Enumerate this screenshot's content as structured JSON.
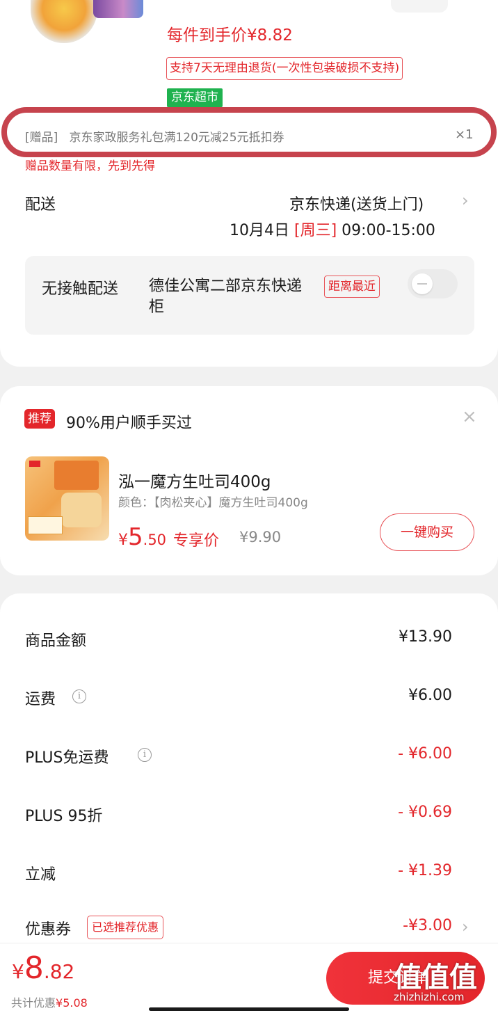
{
  "product": {
    "final_price": "每件到手价¥8.82",
    "return_policy": "支持7天无理由退货(一次性包装破损不支持)",
    "store_badge": "京东超市"
  },
  "gift": {
    "tag": "[赠品]",
    "name": "京东家政服务礼包满120元减25元抵扣券",
    "qty": "×1",
    "note": "赠品数量有限，先到先得"
  },
  "delivery": {
    "label": "配送",
    "method": "京东快递(送货上门)",
    "date": "10月4日",
    "weekday": "[周三]",
    "time": "09:00-15:00",
    "contactless_label": "无接触配送",
    "contactless_location": "德佳公寓二部京东快递柜",
    "distance_badge": "距离最近",
    "contactless_enabled": false
  },
  "recommend": {
    "badge": "推荐",
    "title": "90%用户顺手买过",
    "close": "×",
    "product_name": "泓一魔方生吐司400g",
    "spec": "颜色：【肉松夹心】魔方生吐司400g",
    "price_currency": "¥",
    "price_int": "5",
    "price_dec": ".50",
    "price_label": "专享价",
    "original_price": "¥9.90",
    "buy_button": "一键购买"
  },
  "summary": {
    "rows": [
      {
        "label": "商品金额",
        "value": "¥13.90"
      },
      {
        "label": "运费",
        "value": "¥6.00"
      },
      {
        "label": "PLUS免运费",
        "value": "- ¥6.00"
      },
      {
        "label": "PLUS 95折",
        "value": "- ¥0.69"
      },
      {
        "label": "立减",
        "value": "- ¥1.39"
      },
      {
        "label": "优惠券",
        "value": "-¥3.00"
      }
    ],
    "coupon_badge": "已选推荐优惠"
  },
  "footer": {
    "total_currency": "¥",
    "total_int": "8",
    "total_dec": ".82",
    "saved_label": "共计优惠",
    "saved_value": "¥5.08",
    "submit_button": "提交订单"
  },
  "watermark": {
    "glyphs": "值值值",
    "url": "zhizhizhi.com"
  },
  "colors": {
    "accent": "#e3262b",
    "store_green": "#1fb24f",
    "annotation_ring": "#c6434d"
  }
}
